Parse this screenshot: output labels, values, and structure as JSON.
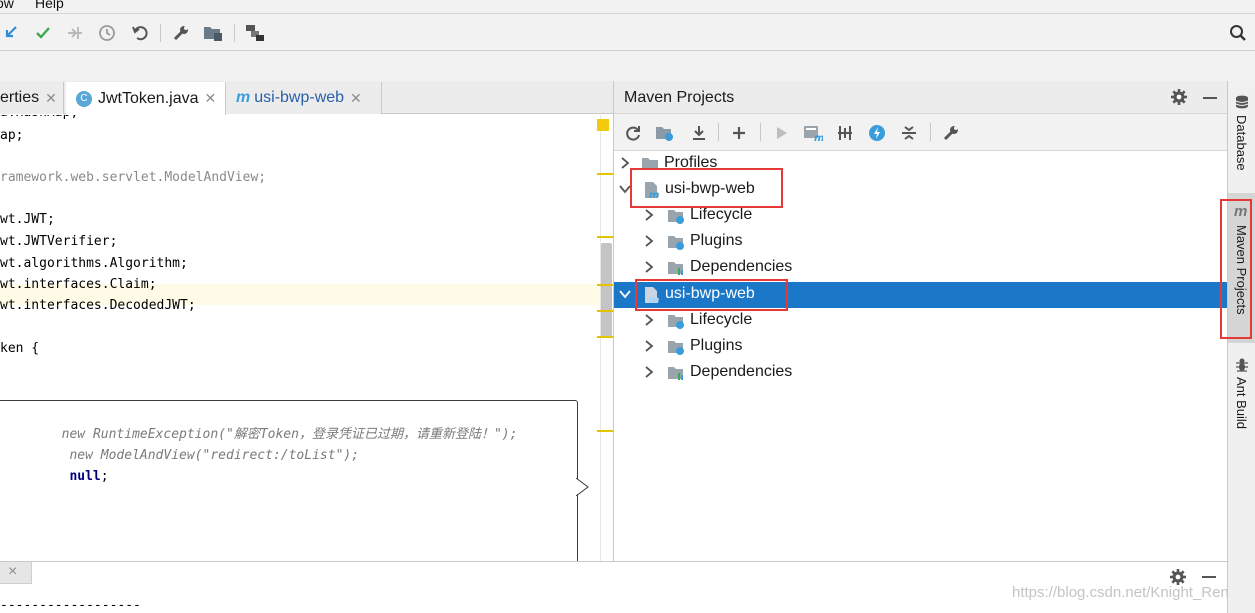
{
  "menu": {
    "items": [
      {
        "label": "ow"
      },
      {
        "label": "Help"
      }
    ]
  },
  "toolbar": {
    "icons": [
      "update-project-icon",
      "commit-icon",
      "pull-icon",
      "history-icon",
      "revert-icon",
      "settings-wrench-icon",
      "project-structure-icon",
      "run-configuration-icon",
      "search-icon"
    ]
  },
  "editor": {
    "tabs": [
      {
        "label": "erties",
        "active": false
      },
      {
        "label": "JwtToken.java",
        "active": true
      },
      {
        "label": "usi-bwp-web",
        "active": false
      }
    ],
    "code_lines": [
      "a.HashMap;",
      "ap;",
      "",
      "ramework.web.servlet.ModelAndView;",
      "",
      "wt.JWT;",
      "wt.JWTVerifier;",
      "wt.algorithms.Algorithm;",
      "wt.interfaces.Claim;",
      "wt.interfaces.DecodedJWT;",
      "",
      "ken {"
    ],
    "popup_lines": [
      {
        "kw": "new ",
        "rest": "RuntimeException(\"解密Token，登录凭证已过期，请重新登陆！\");"
      },
      {
        "kw": " new ",
        "rest": "ModelAndView(\"redirect:/toList\");"
      },
      {
        "kw": " null",
        "rest": ";"
      }
    ]
  },
  "maven": {
    "title": "Maven Projects",
    "tree": [
      {
        "label": "Profiles",
        "level": 0,
        "expanded": false,
        "selected": false,
        "icon": "folder-icon"
      },
      {
        "label": "usi-bwp-web",
        "level": 0,
        "expanded": true,
        "selected": false,
        "icon": "maven-module-icon"
      },
      {
        "label": "Lifecycle",
        "level": 1,
        "expanded": false,
        "selected": false,
        "icon": "lifecycle-folder-icon"
      },
      {
        "label": "Plugins",
        "level": 1,
        "expanded": false,
        "selected": false,
        "icon": "plugins-folder-icon"
      },
      {
        "label": "Dependencies",
        "level": 1,
        "expanded": false,
        "selected": false,
        "icon": "dependencies-folder-icon"
      },
      {
        "label": "usi-bwp-web",
        "level": 0,
        "expanded": true,
        "selected": true,
        "icon": "maven-module-icon"
      },
      {
        "label": "Lifecycle",
        "level": 1,
        "expanded": false,
        "selected": false,
        "icon": "lifecycle-folder-icon"
      },
      {
        "label": "Plugins",
        "level": 1,
        "expanded": false,
        "selected": false,
        "icon": "plugins-folder-icon"
      },
      {
        "label": "Dependencies",
        "level": 1,
        "expanded": false,
        "selected": false,
        "icon": "dependencies-folder-icon"
      }
    ]
  },
  "side_stripe": {
    "items": [
      {
        "label": "Database"
      },
      {
        "label": "Maven Projects"
      },
      {
        "label": "Ant Build"
      }
    ]
  },
  "bottom": {
    "tab_close": "×",
    "dashes": "------------------"
  },
  "watermark": "https://blog.csdn.net/Knight_Ren",
  "colors": {
    "selection": "#1b78c8",
    "highlight_box": "#e53935",
    "keyword": "#000080"
  }
}
